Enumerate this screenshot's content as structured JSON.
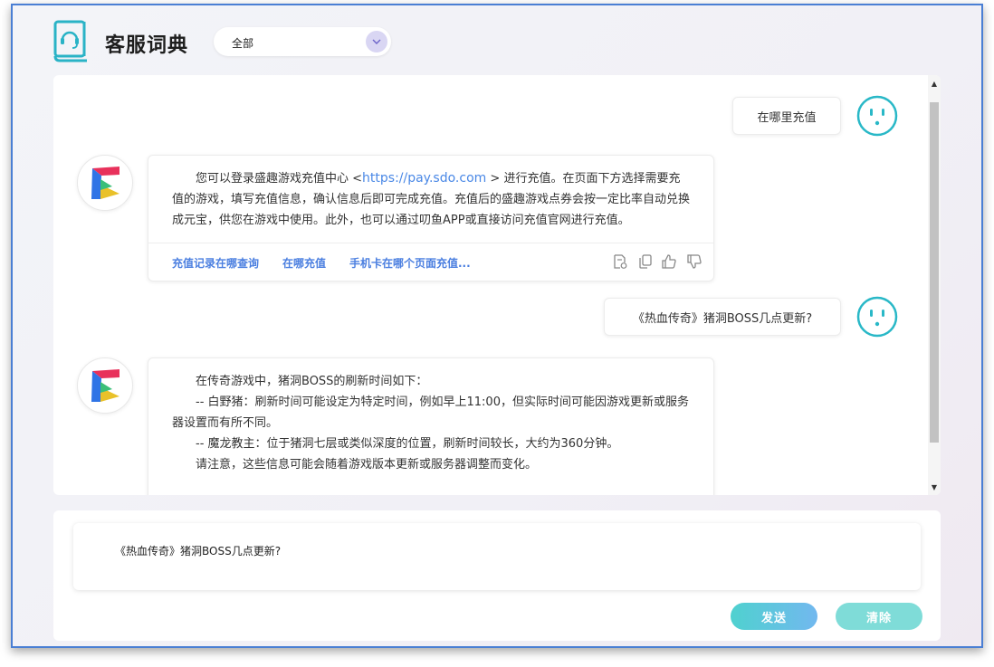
{
  "header": {
    "title": "客服词典",
    "category": {
      "selected": "全部"
    }
  },
  "conversation": [
    {
      "role": "user",
      "text": "在哪里充值"
    },
    {
      "role": "bot",
      "text_before_link": "您可以登录盛趣游戏充值中心 <",
      "link": "https://pay.sdo.com",
      "text_after_link": "   > 进行充值。在页面下方选择需要充值的游戏，填写充值信息，确认信息后即可完成充值。充值后的盛趣游戏点券会按一定比率自动兑换成元宝，供您在游戏中使用。此外，也可以通过叨鱼APP或直接访问充值官网进行充值。",
      "related": [
        "充值记录在哪查询",
        "在哪充值",
        "手机卡在哪个页面充值..."
      ]
    },
    {
      "role": "user",
      "text": "《热血传奇》猪洞BOSS几点更新?"
    },
    {
      "role": "bot",
      "lines": [
        "在传奇游戏中，猪洞BOSS的刷新时间如下：",
        "-- 白野猪：刷新时间可能设定为特定时间，例如早上11:00，但实际时间可能因游戏更新或服务器设置而有所不同。",
        "-- 魔龙教主：位于猪洞七层或类似深度的位置，刷新时间较长，大约为360分钟。",
        "请注意，这些信息可能会随着游戏版本更新或服务器调整而变化。"
      ]
    }
  ],
  "input": {
    "value": "《热血传奇》猪洞BOSS几点更新?"
  },
  "buttons": {
    "send": "发送",
    "clear": "清除"
  },
  "colors": {
    "accent_teal": "#29b8c7",
    "link_blue": "#4b7fe0",
    "send_gradient_start": "#4fd1cf",
    "send_gradient_end": "#72b8ef",
    "clear_bg": "#7fdcd8"
  }
}
